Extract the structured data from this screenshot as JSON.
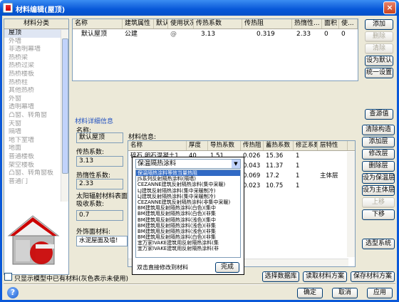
{
  "window": {
    "title": "材料编辑(屋顶)"
  },
  "categories": {
    "header": "材料分类",
    "items": [
      "屋顶",
      "外墙",
      "非透明幕墙",
      "热桥梁",
      "热桥过梁",
      "热桥楼板",
      "热桥柱",
      "其他热桥",
      "外窗",
      "透明幕墙",
      "凸窗、转角窗",
      "天窗",
      "隔墙",
      "地下室墙",
      "地面",
      "普通楼板",
      "架空楼板",
      "凸窗、转角窗板",
      "普通门"
    ]
  },
  "top_table": {
    "headers": [
      "名称",
      "建筑属性",
      "默认",
      "使用状况",
      "传热系数",
      "传热阻",
      "热惰性...",
      "面积",
      "使..."
    ],
    "rows": [
      [
        "默认屋顶",
        "公建",
        "",
        "@",
        "3.13",
        "0.319",
        "2.33",
        "0",
        "0"
      ]
    ]
  },
  "right_buttons": {
    "add": "添加",
    "delete": "删除",
    "clear": "清除",
    "set_default": "设为默认",
    "unify": "统一设置",
    "lookup": "查源值",
    "del_struct": "清除构造",
    "add_layer": "添加层",
    "modify_layer": "修改层",
    "del_layer": "删除层",
    "set_insulation": "设为保温层",
    "set_main": "设为主体层",
    "move_up": "上移",
    "move_down": "下移",
    "select_system": "选型系统"
  },
  "detail": {
    "section_title": "材料详细信息",
    "name_label": "名称:",
    "name_value": "默认屋顶",
    "heat_coef_label": "传热系数:",
    "heat_coef_value": "3.13",
    "inertia_label": "热惰性系数:",
    "inertia_value": "2.33",
    "solar_label": "太阳辐射材料表面吸收系数:",
    "solar_value": "0.7",
    "exterior_label": "外饰面材料:",
    "exterior_value": "水泥屋面及墙!"
  },
  "materials": {
    "label": "材料信息:",
    "headers": [
      "名称",
      "厚度",
      "导热系数",
      "传热阻",
      "蓄热系数",
      "修正系数",
      "层特性"
    ],
    "rows": [
      [
        "碎石,卵石混凝土1",
        "40",
        "1.51",
        "0.026",
        "15.36",
        "1",
        ""
      ],
      [
        "",
        "",
        "",
        "0.043",
        "11.37",
        "1",
        ""
      ],
      [
        "",
        "",
        "",
        "0.069",
        "17.2",
        "1",
        "主体层"
      ],
      [
        "",
        "",
        "",
        "0.023",
        "10.75",
        "1",
        ""
      ]
    ]
  },
  "popup": {
    "combo_value": "保温隔热涂料",
    "items": [
      "保温隔热涂料等效当量热阻",
      "JS系列反射隔热涂料(隔墙)",
      "CEZANNE建筑反射隔热涂料(集中采暖)",
      "LJ建筑反射隔热涂料(集中采暖制冷)",
      "LJ建筑反射隔热涂料(集中采暖制冷)",
      "CEZANNE建筑反射隔热涂料(非集中采暖)",
      "BM建筑用反射隔热涂料(白色)(集中",
      "BM建筑用反射隔热涂料(白色)(非集",
      "BM建筑用反射隔热涂料(浅色)(集中",
      "BM建筑用反射隔热涂料(浅色)(非集",
      "BM建筑用反射隔热涂料(浅色)(非集",
      "BM建筑用反射隔热涂料(白色)(非集",
      "宜万家IVAKE建筑用反射隔热涂料(集",
      "宜万家IVAKE建筑用反射隔热涂料(非"
    ],
    "hint": "双击直接修改到材料",
    "done": "完成"
  },
  "bottom": {
    "checkbox_label": "只显示模型中已有材料(灰色表示未使用)",
    "select_db": "选择数据库",
    "load_scheme": "读取材料方案",
    "save_scheme": "保存材料方案",
    "ok": "确定",
    "cancel": "取消",
    "apply": "应用"
  }
}
